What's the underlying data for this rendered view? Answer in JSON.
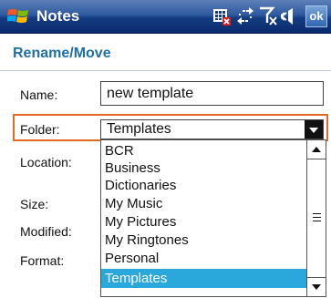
{
  "titlebar": {
    "app_title": "Notes",
    "ok_label": "ok",
    "status_icons": [
      "sim-card-icon",
      "sync-arrows-icon",
      "antenna-off-icon",
      "speaker-icon"
    ]
  },
  "header": {
    "title": "Rename/Move"
  },
  "form": {
    "name_label": "Name:",
    "name_value": "new template",
    "folder_label": "Folder:",
    "folder_value": "Templates",
    "location_label": "Location:",
    "size_label": "Size:",
    "modified_label": "Modified:",
    "format_label": "Format:"
  },
  "dropdown": {
    "options": [
      "BCR",
      "Business",
      "Dictionaries",
      "My Music",
      "My Pictures",
      "My Ringtones",
      "Personal",
      "Templates"
    ],
    "selected": "Templates"
  },
  "colors": {
    "title_bar": "#143c82",
    "header_text": "#1f6fa4",
    "focus_border": "#e16a1e",
    "selection": "#2aa7db"
  }
}
